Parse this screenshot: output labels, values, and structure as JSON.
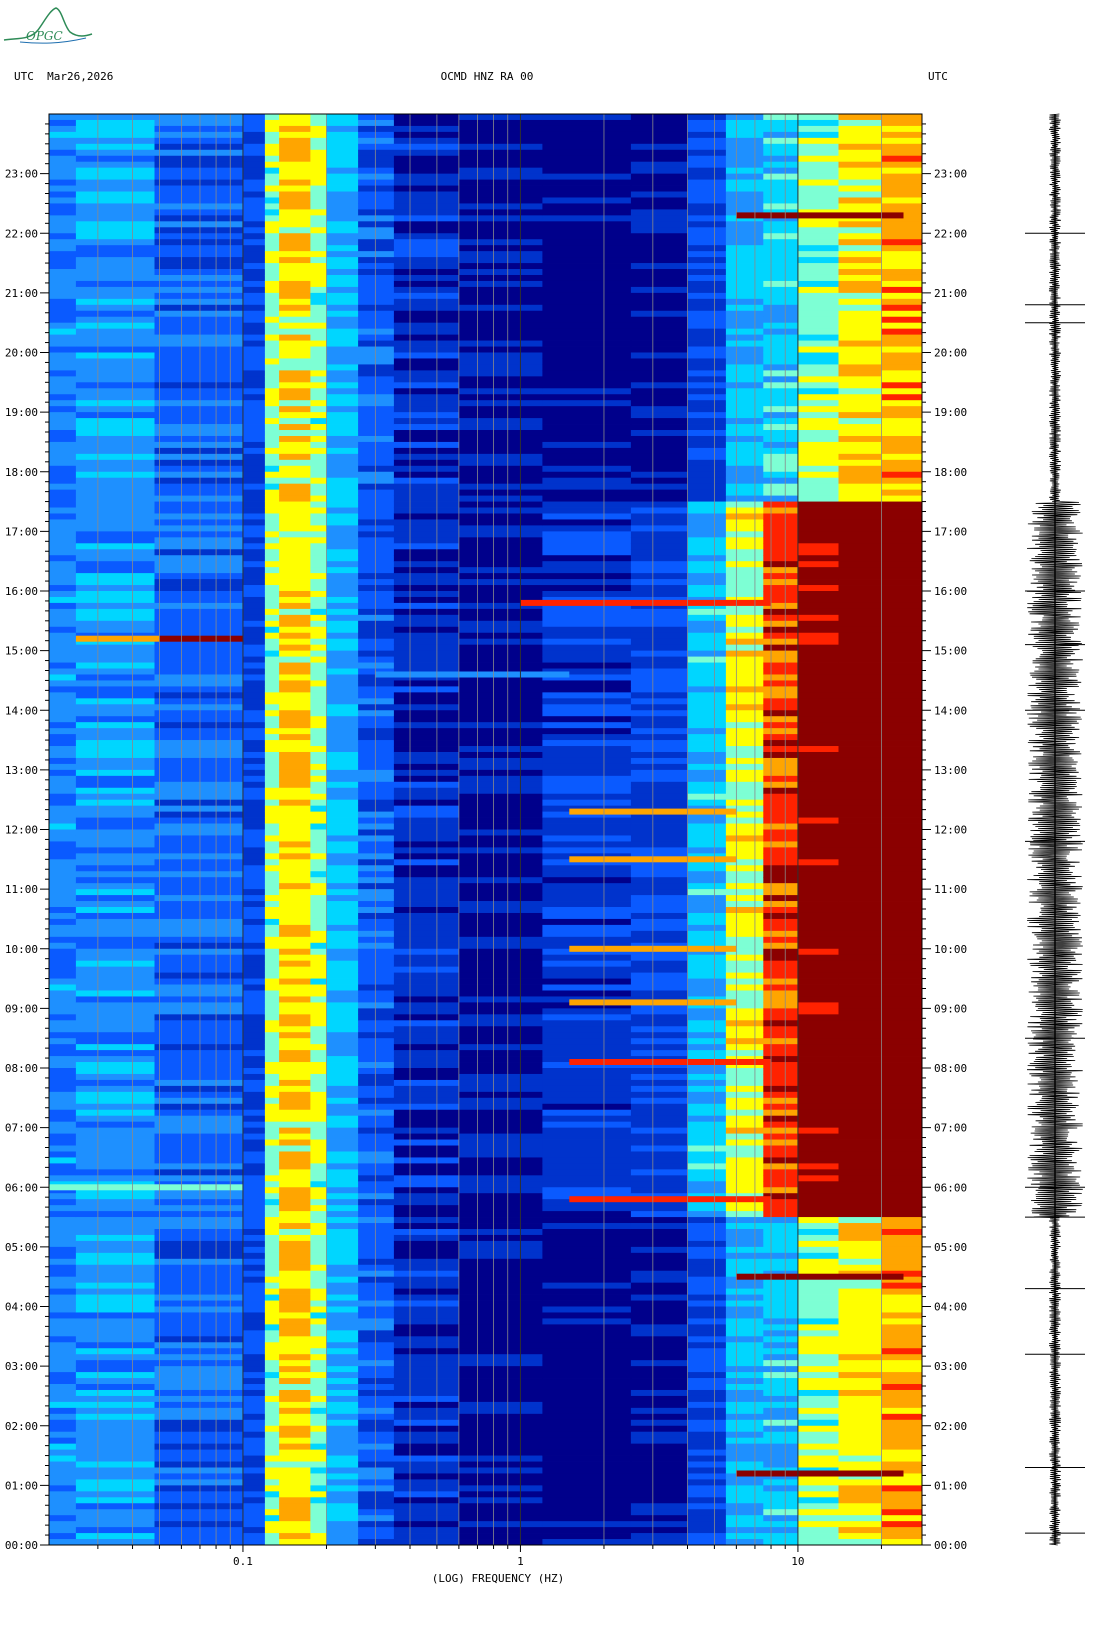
{
  "header": {
    "logo_text": "OPGC",
    "left_label": "UTC  Mar26,2026",
    "title": "OCMD HNZ RA 00",
    "right_label": "UTC"
  },
  "chart_data": {
    "type": "heatmap",
    "title": "OCMD HNZ RA 00",
    "date": "Mar26,2026",
    "timezone": "UTC",
    "xlabel": "(LOG) FREQUENCY (HZ)",
    "x_scale": "log",
    "xlim": [
      0.02,
      28
    ],
    "x_ticks": [
      {
        "value": 0.1,
        "label": "0.1"
      },
      {
        "value": 1,
        "label": "1"
      },
      {
        "value": 10,
        "label": "10"
      }
    ],
    "ylim_hours": [
      0,
      24
    ],
    "y_ticks": [
      "00:00",
      "01:00",
      "02:00",
      "03:00",
      "04:00",
      "05:00",
      "06:00",
      "07:00",
      "08:00",
      "09:00",
      "10:00",
      "11:00",
      "12:00",
      "13:00",
      "14:00",
      "15:00",
      "16:00",
      "17:00",
      "18:00",
      "19:00",
      "20:00",
      "21:00",
      "22:00",
      "23:00"
    ],
    "colormap": [
      "#00008b",
      "#0033cc",
      "#0a5aff",
      "#1e90ff",
      "#00d6ff",
      "#7dffd4",
      "#ffff00",
      "#ffa500",
      "#ff2200",
      "#8b0000"
    ],
    "bands": [
      {
        "f_from": 0.02,
        "f_to": 0.025,
        "level": 0.32
      },
      {
        "f_from": 0.025,
        "f_to": 0.048,
        "level": 0.36
      },
      {
        "f_from": 0.048,
        "f_to": 0.1,
        "level": 0.26
      },
      {
        "f_from": 0.1,
        "f_to": 0.12,
        "level": 0.2
      },
      {
        "f_from": 0.12,
        "f_to": 0.135,
        "level": 0.58
      },
      {
        "f_from": 0.135,
        "f_to": 0.175,
        "level": 0.68
      },
      {
        "f_from": 0.175,
        "f_to": 0.2,
        "level": 0.58
      },
      {
        "f_from": 0.2,
        "f_to": 0.26,
        "level": 0.4
      },
      {
        "f_from": 0.26,
        "f_to": 0.35,
        "level": 0.25
      },
      {
        "f_from": 0.35,
        "f_to": 0.6,
        "level": 0.13
      },
      {
        "f_from": 0.6,
        "f_to": 1.2,
        "level": 0.06
      },
      {
        "f_from": 1.2,
        "f_to": 2.5,
        "level": 0.03
      },
      {
        "f_from": 2.5,
        "f_to": 4,
        "level": 0.06
      },
      {
        "f_from": 4,
        "f_to": 5.5,
        "level": 0.2
      },
      {
        "f_from": 5.5,
        "f_to": 7.5,
        "level": 0.4
      },
      {
        "f_from": 7.5,
        "f_to": 10,
        "level": 0.62
      },
      {
        "f_from": 10,
        "f_to": 14,
        "level": 0.75
      },
      {
        "f_from": 14,
        "f_to": 20,
        "level": 0.85
      },
      {
        "f_from": 20,
        "f_to": 28,
        "level": 0.92
      }
    ],
    "day_activity_hours": [
      5.5,
      17.5
    ],
    "events": [
      {
        "hour": 15.2,
        "f_from": 0.025,
        "f_to": 0.05,
        "level": 0.72
      },
      {
        "hour": 15.2,
        "f_from": 0.05,
        "f_to": 0.1,
        "level": 0.97
      },
      {
        "hour": 15.8,
        "f_from": 1.0,
        "f_to": 8,
        "level": 0.82
      },
      {
        "hour": 8.1,
        "f_from": 1.5,
        "f_to": 8,
        "level": 0.85
      },
      {
        "hour": 5.8,
        "f_from": 1.5,
        "f_to": 8,
        "level": 0.85
      },
      {
        "hour": 12.3,
        "f_from": 1.5,
        "f_to": 6,
        "level": 0.7
      },
      {
        "hour": 11.5,
        "f_from": 1.5,
        "f_to": 6,
        "level": 0.75
      },
      {
        "hour": 10.0,
        "f_from": 1.5,
        "f_to": 6,
        "level": 0.7
      },
      {
        "hour": 9.1,
        "f_from": 1.5,
        "f_to": 6,
        "level": 0.7
      },
      {
        "hour": 6.0,
        "f_from": 0.02,
        "f_to": 0.1,
        "level": 0.55
      },
      {
        "hour": 14.6,
        "f_from": 0.3,
        "f_to": 1.5,
        "level": 0.3
      },
      {
        "hour": 1.2,
        "f_from": 6,
        "f_to": 24,
        "level": 0.9
      },
      {
        "hour": 4.5,
        "f_from": 6,
        "f_to": 24,
        "level": 0.9
      },
      {
        "hour": 22.3,
        "f_from": 6,
        "f_to": 24,
        "level": 0.9
      }
    ],
    "seismogram": {
      "label": "trace",
      "quiet_amplitude": 0.15,
      "active_amplitude": 0.7,
      "spikes_hours": [
        0.2,
        1.3,
        3.2,
        4.3,
        5.5,
        6.0,
        8.5,
        11.8,
        14.0,
        15.1,
        16.0,
        20.5,
        20.8,
        22.0
      ]
    }
  }
}
